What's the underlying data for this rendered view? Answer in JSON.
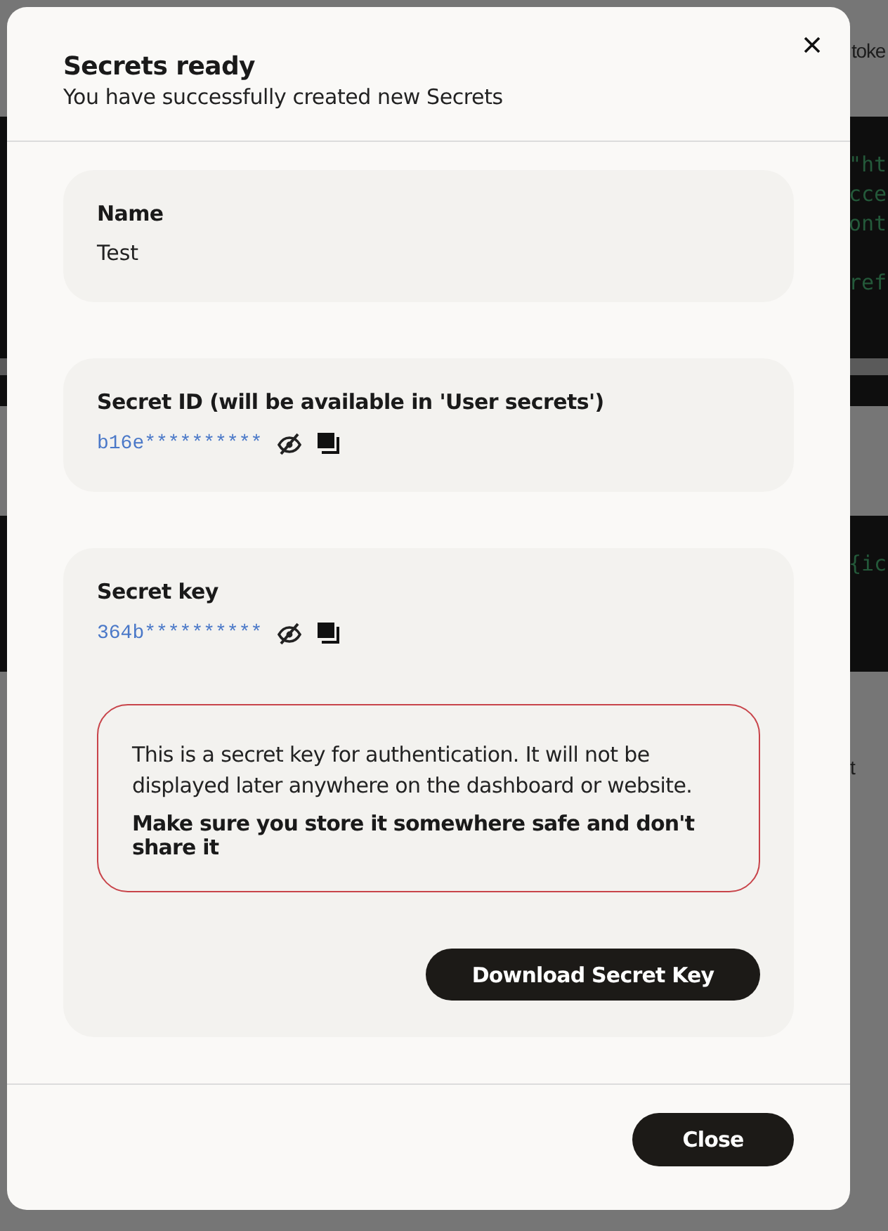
{
  "background": {
    "header_fragment": "toke",
    "code_blocks": [
      {
        "lines": [
          "\"ht",
          "cce",
          "ont",
          "ref"
        ]
      },
      {
        "lines": [
          "{ic"
        ]
      }
    ],
    "after_fragment": "t"
  },
  "dialog": {
    "title": "Secrets ready",
    "subtitle": "You have successfully created new Secrets",
    "sections": [
      {
        "kind": "plain",
        "label": "Name",
        "value": "Test"
      },
      {
        "kind": "secret",
        "label": "Secret ID (will be available in 'User secrets')",
        "value": "b16e**********",
        "revealed": false
      },
      {
        "kind": "secret",
        "label": "Secret key",
        "value": "364b**********",
        "revealed": false,
        "warning": {
          "text": "This is a secret key for authentication. It will not be displayed later anywhere on the dashboard or website.",
          "emphasis": "Make sure you store it somewhere safe and don't share it"
        },
        "action": "Download Secret Key"
      }
    ],
    "close_button": "Close"
  }
}
